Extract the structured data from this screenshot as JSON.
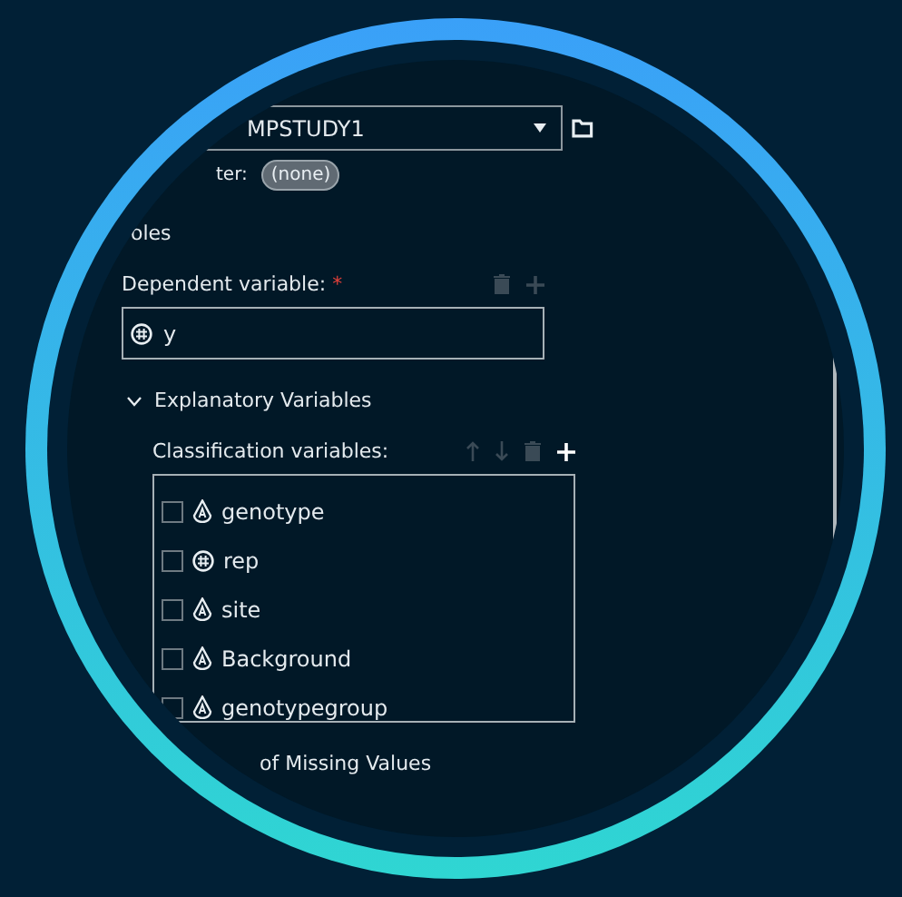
{
  "dataset": {
    "value": "MPSTUDY1"
  },
  "filter": {
    "label": "ter:",
    "value": "(none)"
  },
  "roles_heading": "oles",
  "dependent": {
    "label": "Dependent variable:",
    "required_mark": "*",
    "tools": [
      {
        "kind": "delete",
        "disabled": true
      },
      {
        "kind": "add",
        "disabled": true
      }
    ],
    "variables": [
      {
        "name": "y",
        "kind": "numeric"
      }
    ]
  },
  "explanatory": {
    "title": "Explanatory Variables",
    "expanded": true,
    "classification": {
      "label": "Classification variables:",
      "tools": [
        {
          "kind": "up",
          "disabled": true
        },
        {
          "kind": "down",
          "disabled": true
        },
        {
          "kind": "delete",
          "disabled": true
        },
        {
          "kind": "add",
          "disabled": false
        }
      ],
      "variables": [
        {
          "name": "genotype",
          "kind": "character",
          "checked": false
        },
        {
          "name": "rep",
          "kind": "numeric",
          "checked": false
        },
        {
          "name": "site",
          "kind": "character",
          "checked": false
        },
        {
          "name": "Background",
          "kind": "character",
          "checked": false
        },
        {
          "name": "genotypegroup",
          "kind": "character",
          "checked": false
        }
      ]
    }
  },
  "next_section": "of Missing Values"
}
